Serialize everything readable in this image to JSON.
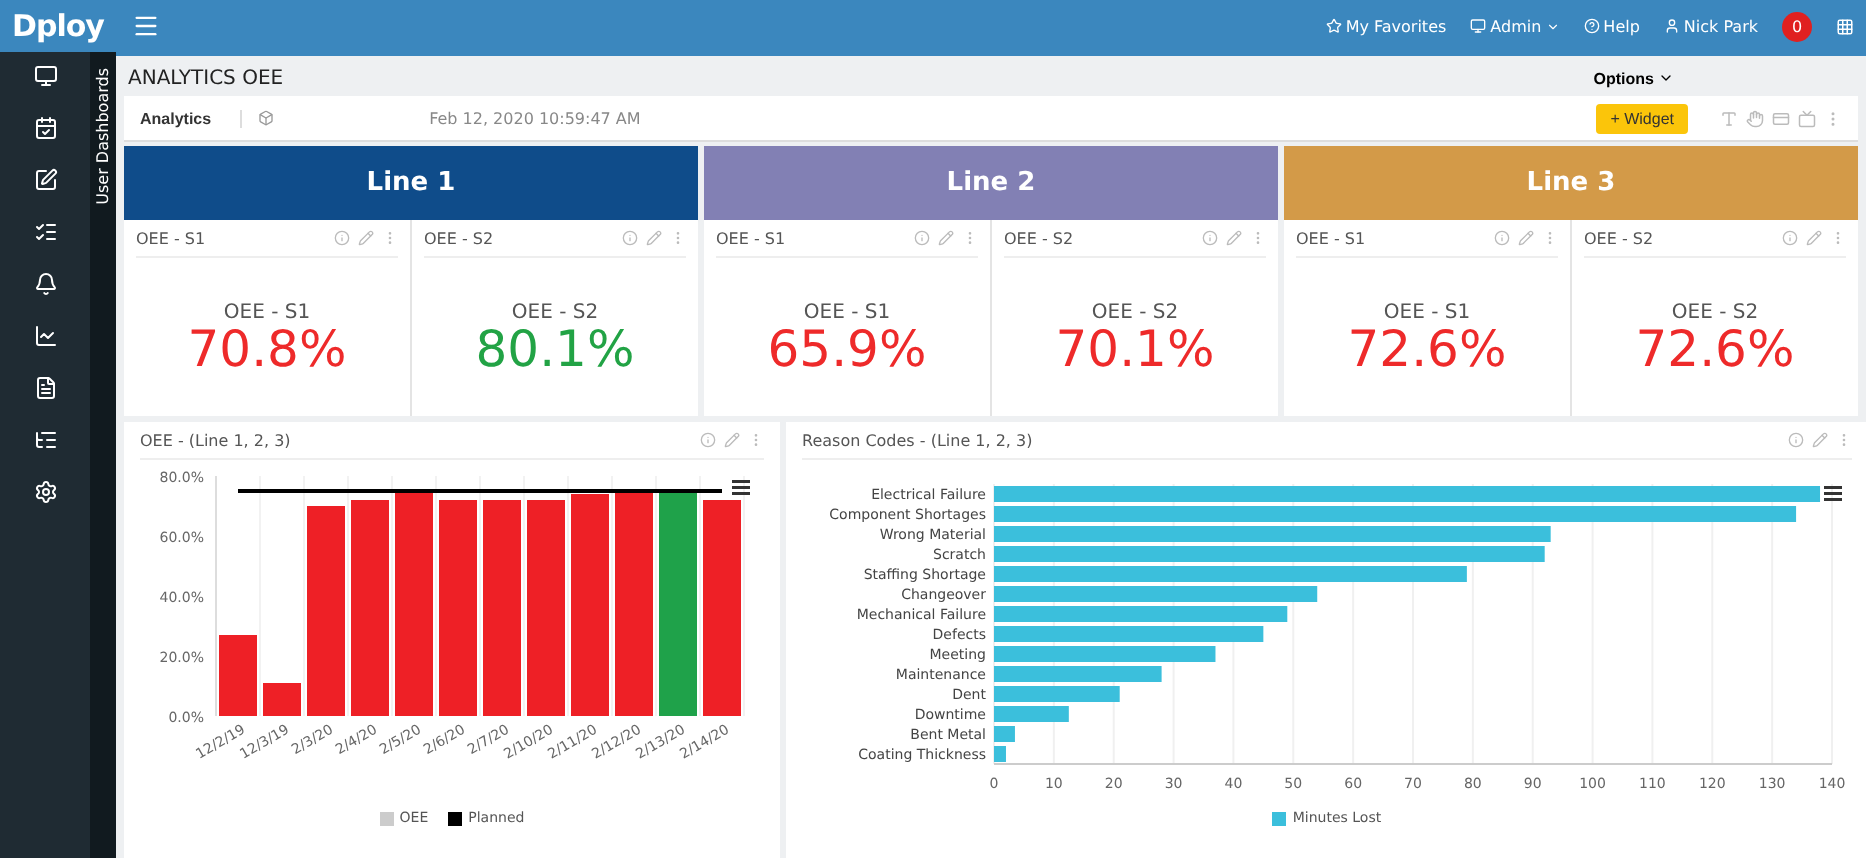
{
  "topbar": {
    "logo": "Dploy",
    "links": [
      {
        "kind": "favorites",
        "label": "My Favorites"
      },
      {
        "kind": "admin",
        "label": "Admin"
      },
      {
        "kind": "help",
        "label": "Help"
      },
      {
        "kind": "user",
        "label": "Nick Park"
      }
    ],
    "notifications": "0"
  },
  "sidebar": {
    "panel_label": "User Dashboards"
  },
  "page": {
    "title": "ANALYTICS OEE",
    "options": "Options"
  },
  "toolbar": {
    "tab": "Analytics",
    "timestamp": "Feb 12, 2020 10:59:47 AM",
    "widget_button": "+ Widget"
  },
  "lines": [
    {
      "title": "Line 1",
      "color": "#0f4c8a",
      "cards": [
        {
          "header": "OEE - S1",
          "label": "OEE - S1",
          "value": "70.8%",
          "color": "#ee2a2a"
        },
        {
          "header": "OEE - S2",
          "label": "OEE - S2",
          "value": "80.1%",
          "color": "#22a345"
        }
      ]
    },
    {
      "title": "Line 2",
      "color": "#8280b4",
      "cards": [
        {
          "header": "OEE - S1",
          "label": "OEE - S1",
          "value": "65.9%",
          "color": "#ee2a2a"
        },
        {
          "header": "OEE - S2",
          "label": "OEE - S2",
          "value": "70.1%",
          "color": "#ee2a2a"
        }
      ]
    },
    {
      "title": "Line 3",
      "color": "#d39a48",
      "cards": [
        {
          "header": "OEE - S1",
          "label": "OEE - S1",
          "value": "72.6%",
          "color": "#ee2a2a"
        },
        {
          "header": "OEE - S2",
          "label": "OEE - S2",
          "value": "72.6%",
          "color": "#ee2a2a"
        }
      ]
    }
  ],
  "oee_panel": {
    "title": "OEE - (Line 1, 2, 3)",
    "legend": [
      {
        "color": "#cccccc"
      },
      {
        "color": "#000000"
      }
    ],
    "chart_data": {
      "type": "bar",
      "categories": [
        "12/2/19",
        "12/3/19",
        "2/3/20",
        "2/4/20",
        "2/5/20",
        "2/6/20",
        "2/7/20",
        "2/10/20",
        "2/11/20",
        "2/12/20",
        "2/13/20",
        "2/14/20"
      ],
      "series": [
        {
          "name": "OEE",
          "colors": [
            "#ee2026",
            "#ee2026",
            "#ee2026",
            "#ee2026",
            "#ee2026",
            "#ee2026",
            "#ee2026",
            "#ee2026",
            "#ee2026",
            "#ee2026",
            "#1fa24a",
            "#ee2026"
          ],
          "values": [
            27,
            11,
            70,
            72,
            75,
            72,
            72,
            72,
            74,
            75,
            75,
            72
          ]
        },
        {
          "name": "Planned",
          "color": "#000000",
          "type": "line",
          "values": [
            75,
            75,
            75,
            75,
            75,
            75,
            75,
            75,
            75,
            75,
            75,
            75
          ]
        }
      ],
      "grid": true,
      "ylim": [
        0,
        80
      ],
      "yticks": [
        {
          "value": 0,
          "label": "0.0%"
        },
        {
          "value": 20,
          "label": "20.0%"
        },
        {
          "value": 40,
          "label": "40.0%"
        },
        {
          "value": 60,
          "label": "60.0%"
        },
        {
          "value": 80,
          "label": "80.0%"
        }
      ]
    }
  },
  "reason_panel": {
    "title": "Reason Codes - (Line 1, 2, 3)",
    "chart_data": {
      "type": "bar",
      "orientation": "horizontal",
      "categories": [
        "Electrical Failure",
        "Component Shortages",
        "Wrong Material",
        "Scratch",
        "Staffing Shortage",
        "Changeover",
        "Mechanical Failure",
        "Defects",
        "Meeting",
        "Maintenance",
        "Dent",
        "Downtime",
        "Bent Metal",
        "Coating Thickness"
      ],
      "series": [
        {
          "name": "Minutes Lost",
          "color": "#3bbfdc",
          "values": [
            138,
            134,
            93,
            92,
            79,
            54,
            49,
            45,
            37,
            28,
            21,
            12.5,
            3.5,
            2
          ]
        }
      ],
      "grid": true,
      "xlim": [
        0,
        140
      ],
      "xticks": [
        0,
        10,
        20,
        30,
        40,
        50,
        60,
        70,
        80,
        90,
        100,
        110,
        120,
        130,
        140
      ]
    }
  }
}
